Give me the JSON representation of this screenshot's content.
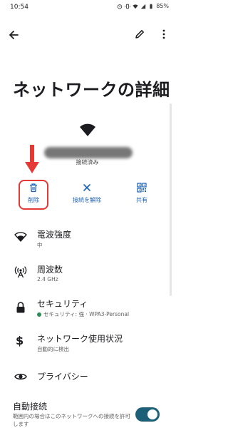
{
  "status_bar": {
    "time": "10:54",
    "battery": "85%"
  },
  "toolbar": {
    "back_icon": "arrow-back-icon",
    "edit_icon": "pencil-icon",
    "more_icon": "more-vert-icon"
  },
  "page": {
    "title": "ネットワークの詳細"
  },
  "network": {
    "status": "接続済み"
  },
  "actions": [
    {
      "label": "削除",
      "icon": "trash-icon"
    },
    {
      "label": "接続を解除",
      "icon": "close-icon"
    },
    {
      "label": "共有",
      "icon": "qr-code-icon"
    }
  ],
  "details": [
    {
      "title": "電波強度",
      "value": "中",
      "icon": "wifi-icon"
    },
    {
      "title": "周波数",
      "value": "2.4 GHz",
      "icon": "antenna-icon"
    },
    {
      "title": "セキュリティ",
      "value": "セキュリティ: 強 · WPA3-Personal",
      "icon": "lock-icon"
    },
    {
      "title": "ネットワーク使用状況",
      "value": "自動的に検出",
      "icon": "dollar-icon"
    },
    {
      "title": "プライバシー",
      "value": "",
      "icon": "eye-icon"
    }
  ],
  "auto_connect": {
    "title": "自動接続",
    "description": "範囲内の場合はこのネットワークへの接続を許可します",
    "enabled": true
  },
  "colors": {
    "accent": "#1a5fb4",
    "highlight": "#e53935",
    "toggle": "#1e5f78"
  }
}
